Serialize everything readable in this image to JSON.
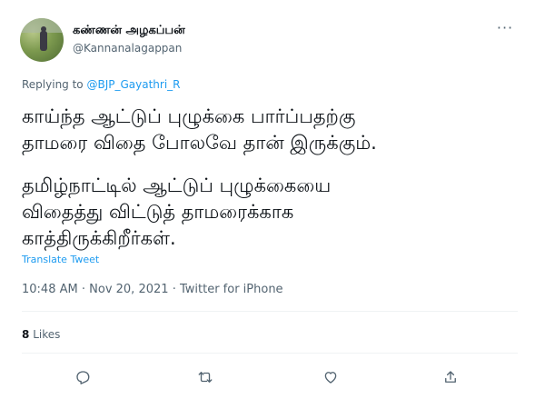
{
  "author": {
    "name": "கண்ணன் அழகப்பன்",
    "handle": "@Kannanalagappan"
  },
  "more_label": "···",
  "reply": {
    "prefix": "Replying to",
    "target": "@BJP_Gayathri_R"
  },
  "tweet": {
    "paragraph1": [
      "காய்ந்த ஆட்டுப் புழுக்கை பார்ப்பதற்கு",
      "தாமரை விதை போலவே தான் இருக்கும்."
    ],
    "paragraph2": [
      "தமிழ்நாட்டில் ஆட்டுப் புழுக்கையை",
      "விதைத்து விட்டுத் தாமரைக்காக",
      "காத்திருக்கிறீர்கள்."
    ]
  },
  "translate_label": "Translate Tweet",
  "meta": {
    "time": "10:48 AM",
    "date": "Nov 20, 2021",
    "source": "Twitter for iPhone",
    "separator": "·"
  },
  "stats": {
    "likes_count": "8",
    "likes_label": "Likes"
  },
  "actions": [
    {
      "name": "reply",
      "icon": "reply-icon"
    },
    {
      "name": "retweet",
      "icon": "retweet-icon"
    },
    {
      "name": "like",
      "icon": "heart-icon"
    },
    {
      "name": "share",
      "icon": "share-icon"
    }
  ],
  "colors": {
    "accent": "#1d9bf0",
    "secondary_text": "#536471",
    "primary_text": "#0f1419",
    "divider": "#eff3f4"
  }
}
